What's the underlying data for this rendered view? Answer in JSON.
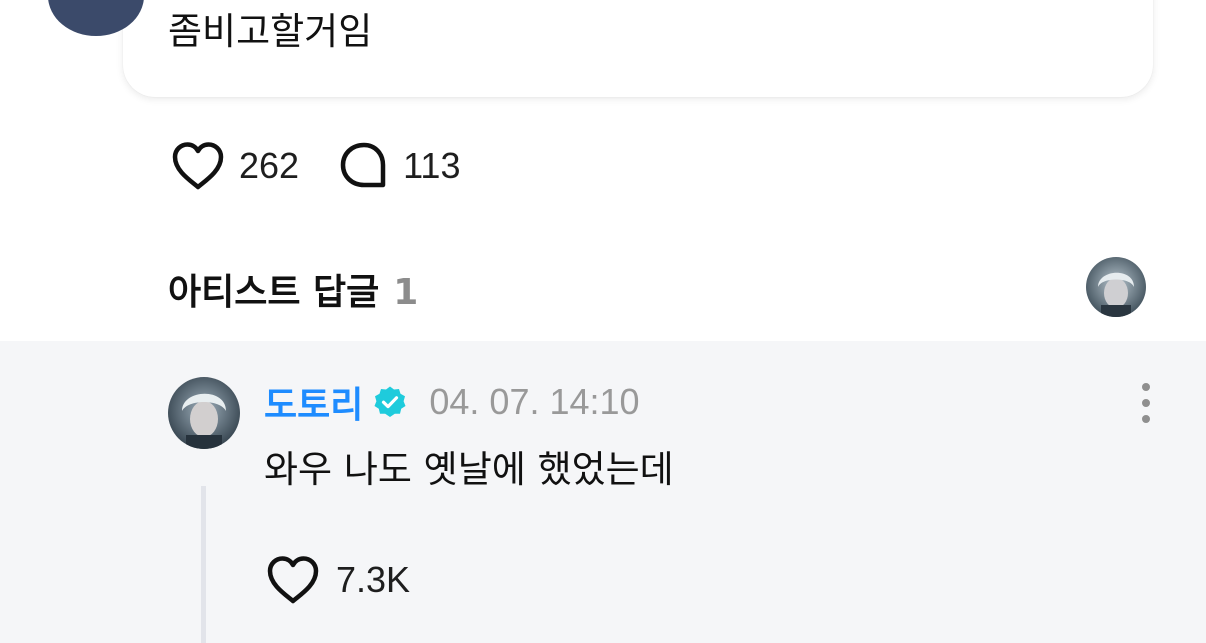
{
  "post": {
    "text": "좀비고할거임",
    "like_count": "262",
    "comment_count": "113"
  },
  "artist_replies": {
    "title": "아티스트 답글",
    "count": "1"
  },
  "reply": {
    "author": "도토리",
    "timestamp": "04. 07. 14:10",
    "text": "와우 나도 옛날에 했었는데",
    "like_count": "7.3K"
  },
  "colors": {
    "author_name": "#1e8cff",
    "verified_badge": "#1ecbdc",
    "reply_background": "#f5f6f8"
  },
  "icons": {
    "like": "heart-icon",
    "comment": "speech-bubble-icon",
    "verified": "verified-badge-icon",
    "more": "more-vertical-icon"
  }
}
